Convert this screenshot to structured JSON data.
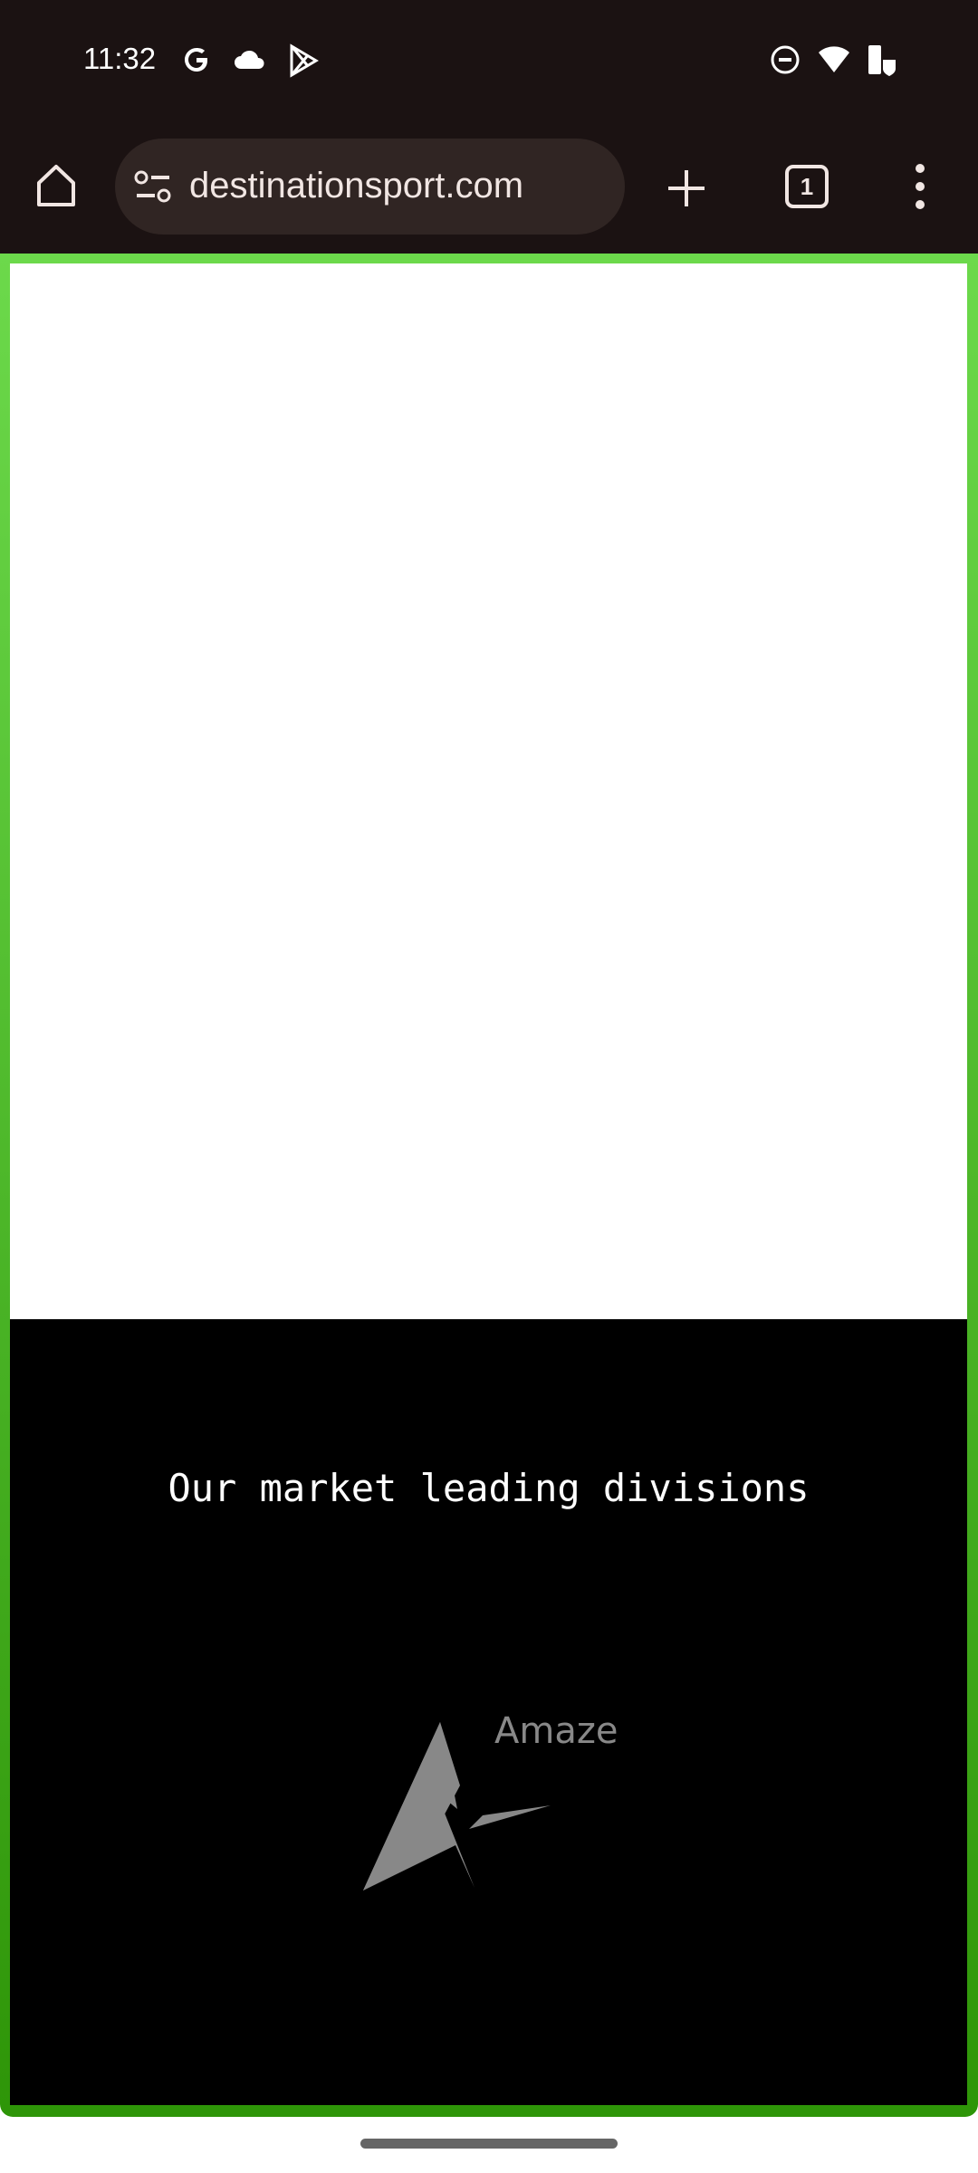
{
  "status_bar": {
    "time": "11:32",
    "left_icons": [
      "google-icon",
      "cloud-icon",
      "play-store-icon"
    ],
    "right_icons": [
      "dnd-icon",
      "wifi-icon",
      "battery-charging-icon"
    ]
  },
  "browser": {
    "url": "destinationsport.com",
    "tab_count": "1",
    "icons": [
      "home-icon",
      "site-settings-icon",
      "new-tab-icon",
      "tabs-icon",
      "more-icon"
    ]
  },
  "page": {
    "heading": "Our market leading divisions",
    "logo_text": "Amaze"
  },
  "colors": {
    "frame_top": "#6cd94b",
    "frame_bottom": "#2e9508",
    "toolbar": "#1b1212",
    "logo": "#888888"
  }
}
